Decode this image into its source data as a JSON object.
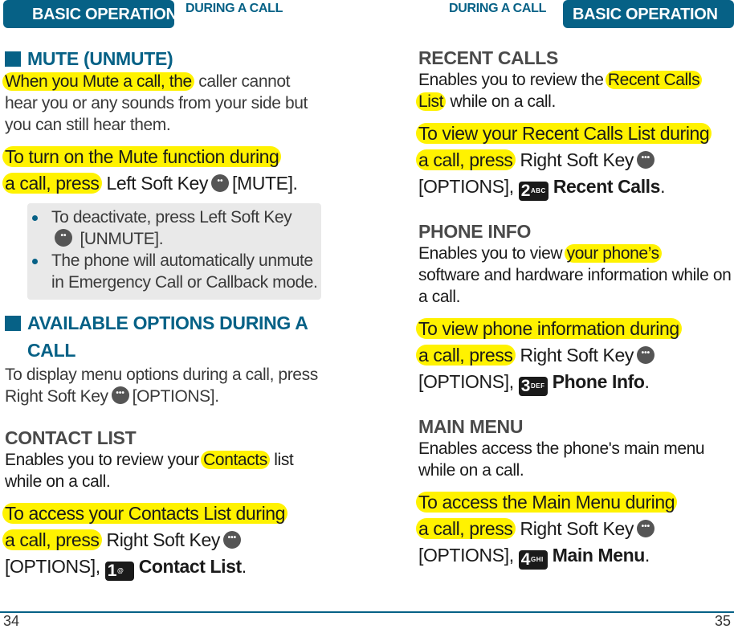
{
  "left_page": {
    "section_tab": "BASIC OPERATION",
    "sub_tab": "DURING A CALL",
    "page_number": "34",
    "mute": {
      "heading": "MUTE (UNMUTE)",
      "desc_highlight": "When you Mute a call, the",
      "desc_rest": "caller cannot hear you or any sounds from your side but you can still hear them.",
      "instr_highlight_1": "To turn on the Mute function during",
      "instr_highlight_2": "a call, press",
      "instr_key": "Left Soft Key",
      "instr_action": "[MUTE].",
      "notes": [
        {
          "before": "To deactivate, press Left Soft Key",
          "after": "[UNMUTE]."
        },
        {
          "text": "The phone will automatically unmute in Emergency Call or Callback mode."
        }
      ]
    },
    "options": {
      "heading": "AVAILABLE OPTIONS DURING A CALL",
      "desc_before": "To display menu options during a call, press Right Soft Key",
      "desc_after": "[OPTIONS]."
    },
    "contact_list": {
      "heading": "CONTACT LIST",
      "desc_before": "Enables you to review your",
      "desc_highlight": "Contacts",
      "desc_after": "list while on a call.",
      "instr_highlight_1": "To access your Contacts List during",
      "instr_highlight_2": "a call, press",
      "instr_key": "Right Soft Key",
      "instr_options": "[OPTIONS],",
      "num_key": "1",
      "num_key_sub": "@",
      "instr_target": "Contact List",
      "instr_end": "."
    }
  },
  "right_page": {
    "section_tab": "BASIC OPERATION",
    "sub_tab": "DURING A CALL",
    "page_number": "35",
    "recent_calls": {
      "heading": "RECENT CALLS",
      "desc_before": "Enables you to review the",
      "desc_highlight_1": "Recent Calls",
      "desc_highlight_2": "List",
      "desc_after": "while on a call.",
      "instr_highlight_1": "To view your Recent Calls List during",
      "instr_highlight_2": "a call, press",
      "instr_key": "Right Soft Key",
      "instr_options": "[OPTIONS],",
      "num_key": "2",
      "num_key_sub": "ABC",
      "instr_target": "Recent Calls",
      "instr_end": "."
    },
    "phone_info": {
      "heading": "PHONE INFO",
      "desc_before": "Enables you to view",
      "desc_highlight": "your phone’s",
      "desc_after": "software and hardware information while on a call.",
      "instr_highlight_1": "To view phone information during",
      "instr_highlight_2": "a call, press",
      "instr_key": "Right Soft Key",
      "instr_options": "[OPTIONS],",
      "num_key": "3",
      "num_key_sub": "DEF",
      "instr_target": "Phone Info",
      "instr_end": "."
    },
    "main_menu": {
      "heading": "MAIN MENU",
      "desc": "Enables access the phone's main menu while on a call.",
      "instr_highlight_1": "To access the Main Menu during",
      "instr_highlight_2": "a call, press",
      "instr_key": "Right Soft Key",
      "instr_options": "[OPTIONS],",
      "num_key": "4",
      "num_key_sub": "GHI",
      "instr_target": "Main Menu",
      "instr_end": "."
    }
  },
  "colors": {
    "brand_blue": "#066186",
    "highlight_yellow": "#fff200",
    "note_bg": "#e9e9e9"
  }
}
